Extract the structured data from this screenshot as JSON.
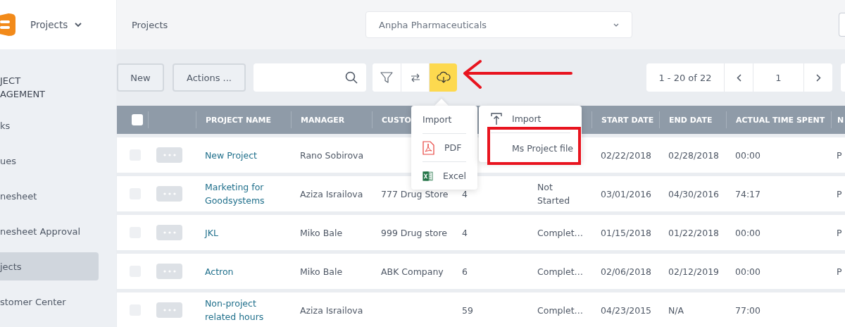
{
  "topbar": {
    "module": "Projects",
    "breadcrumb": "Projects",
    "company": "Anpha Pharmaceuticals"
  },
  "sidebar": {
    "heading": "JECT\nAGEMENT",
    "items": [
      {
        "label": "ks",
        "selected": false
      },
      {
        "label": "ues",
        "selected": false
      },
      {
        "label": "nesheet",
        "selected": false
      },
      {
        "label": "nesheet Approval",
        "selected": false
      },
      {
        "label": "jects",
        "selected": true
      },
      {
        "label": "stomer Center",
        "selected": false
      }
    ]
  },
  "toolbar": {
    "buttons": [
      "New",
      "Actions ..."
    ],
    "tools": [
      {
        "kind": "filter",
        "selected": false
      },
      {
        "kind": "swap",
        "selected": false
      },
      {
        "kind": "download",
        "selected": true
      }
    ],
    "pagination": {
      "range": "1 - 20 of 22",
      "page": "1"
    }
  },
  "table": {
    "header_checked": false,
    "columns": [
      "PROJECT NAME",
      "MANAGER",
      "CUSTO",
      "START DATE",
      "END DATE",
      "ACTUAL TIME SPENT",
      "N"
    ],
    "rows": [
      {
        "checked": false,
        "name": "New Project",
        "manager": "Rano Sobirova",
        "start_date": "02/22/2018",
        "end_date": "02/28/2018",
        "time_spent": "00:00",
        "column_11": "P"
      },
      {
        "checked": false,
        "name": "Marketing for Goodsystems",
        "manager": "Aziza Israilova",
        "customer": "777 Drug Store",
        "column_6": "4",
        "column_7": "Not Started",
        "start_date": "03/01/2016",
        "end_date": "04/30/2016",
        "time_spent": "74:17",
        "column_11": "P"
      },
      {
        "checked": false,
        "name": "JKL",
        "manager": "Miko Bale",
        "customer": "999 Drug store",
        "column_6": "4",
        "column_7": "Complet…",
        "start_date": "01/15/2018",
        "end_date": "01/22/2018",
        "time_spent": "00:00",
        "column_11": "P"
      },
      {
        "checked": false,
        "name": "Actron",
        "manager": "Miko Bale",
        "customer": "ABK Company",
        "column_6": "6",
        "column_7": "Complet…",
        "start_date": "02/06/2018",
        "end_date": "02/12/2019",
        "time_spent": "00:00",
        "column_11": "P"
      },
      {
        "checked": false,
        "name": "Non-project related hours",
        "manager": "Aziza Israilova",
        "column_6": "59",
        "column_7": "Complet…",
        "start_date": "04/23/2015",
        "end_date": "N/A",
        "time_spent": "77:00"
      }
    ]
  },
  "export_menu": {
    "items": [
      {
        "kind": "submenu",
        "label": "Import"
      },
      {
        "kind": "pdf",
        "label": "PDF"
      },
      {
        "kind": "excel",
        "label": "Excel"
      }
    ]
  },
  "import_menu": {
    "items": [
      {
        "kind": "upload",
        "label": "Import"
      },
      {
        "kind": "plain",
        "label": "Ms Project file",
        "highlighted": true
      }
    ]
  }
}
